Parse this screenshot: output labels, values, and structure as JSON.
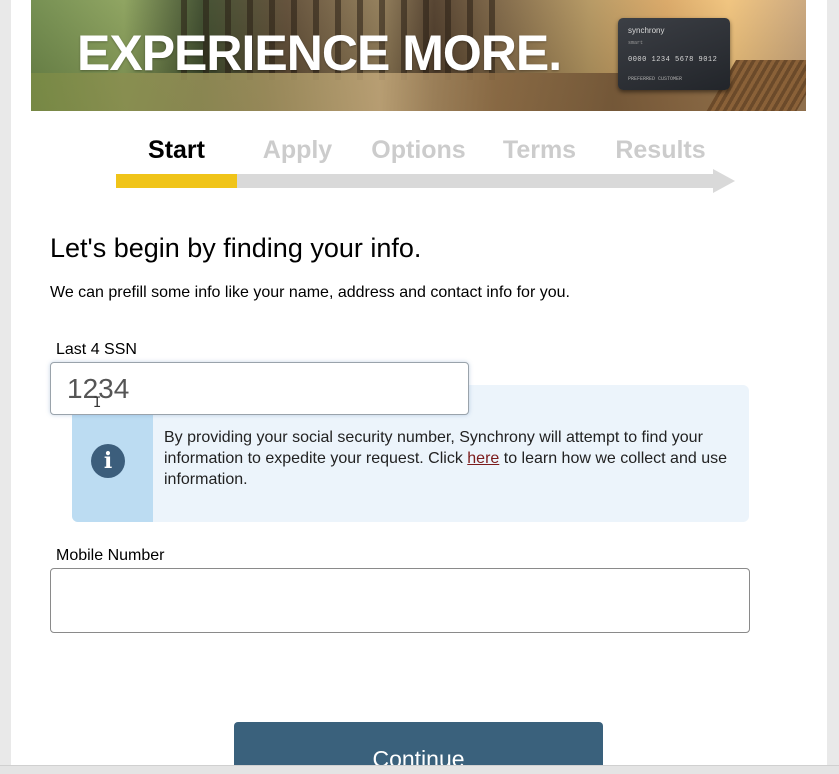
{
  "banner": {
    "headline": "EXPERIENCE MORE.",
    "card": {
      "brand": "synchrony",
      "chip_text": "smart",
      "number": "0000 1234 5678 9012",
      "holder": "PREFERRED CUSTOMER"
    }
  },
  "steps": [
    {
      "label": "Start",
      "active": true
    },
    {
      "label": "Apply",
      "active": false
    },
    {
      "label": "Options",
      "active": false
    },
    {
      "label": "Terms",
      "active": false
    },
    {
      "label": "Results",
      "active": false
    }
  ],
  "progress": {
    "completed_steps": 1,
    "total_steps": 5,
    "fill_color": "#f0c419",
    "track_color": "#d9d9d9"
  },
  "form": {
    "title": "Let's begin by finding your info.",
    "subtitle": "We can prefill some info like your name, address and contact info for you.",
    "ssn": {
      "label": "Last 4 SSN",
      "value": "1234"
    },
    "info": {
      "icon": "info-icon",
      "text_before": "By providing your social security number, Synchrony will attempt to find your information to expedite your request. Click ",
      "link_text": "here",
      "text_after": " to learn how we collect and use information."
    },
    "mobile": {
      "label": "Mobile Number",
      "value": ""
    },
    "continue_label": "Continue"
  },
  "colors": {
    "primary_button": "#3a617c",
    "info_bg": "#ecf4fb",
    "info_side": "#bcdcf2",
    "link": "#7b1b1b"
  }
}
